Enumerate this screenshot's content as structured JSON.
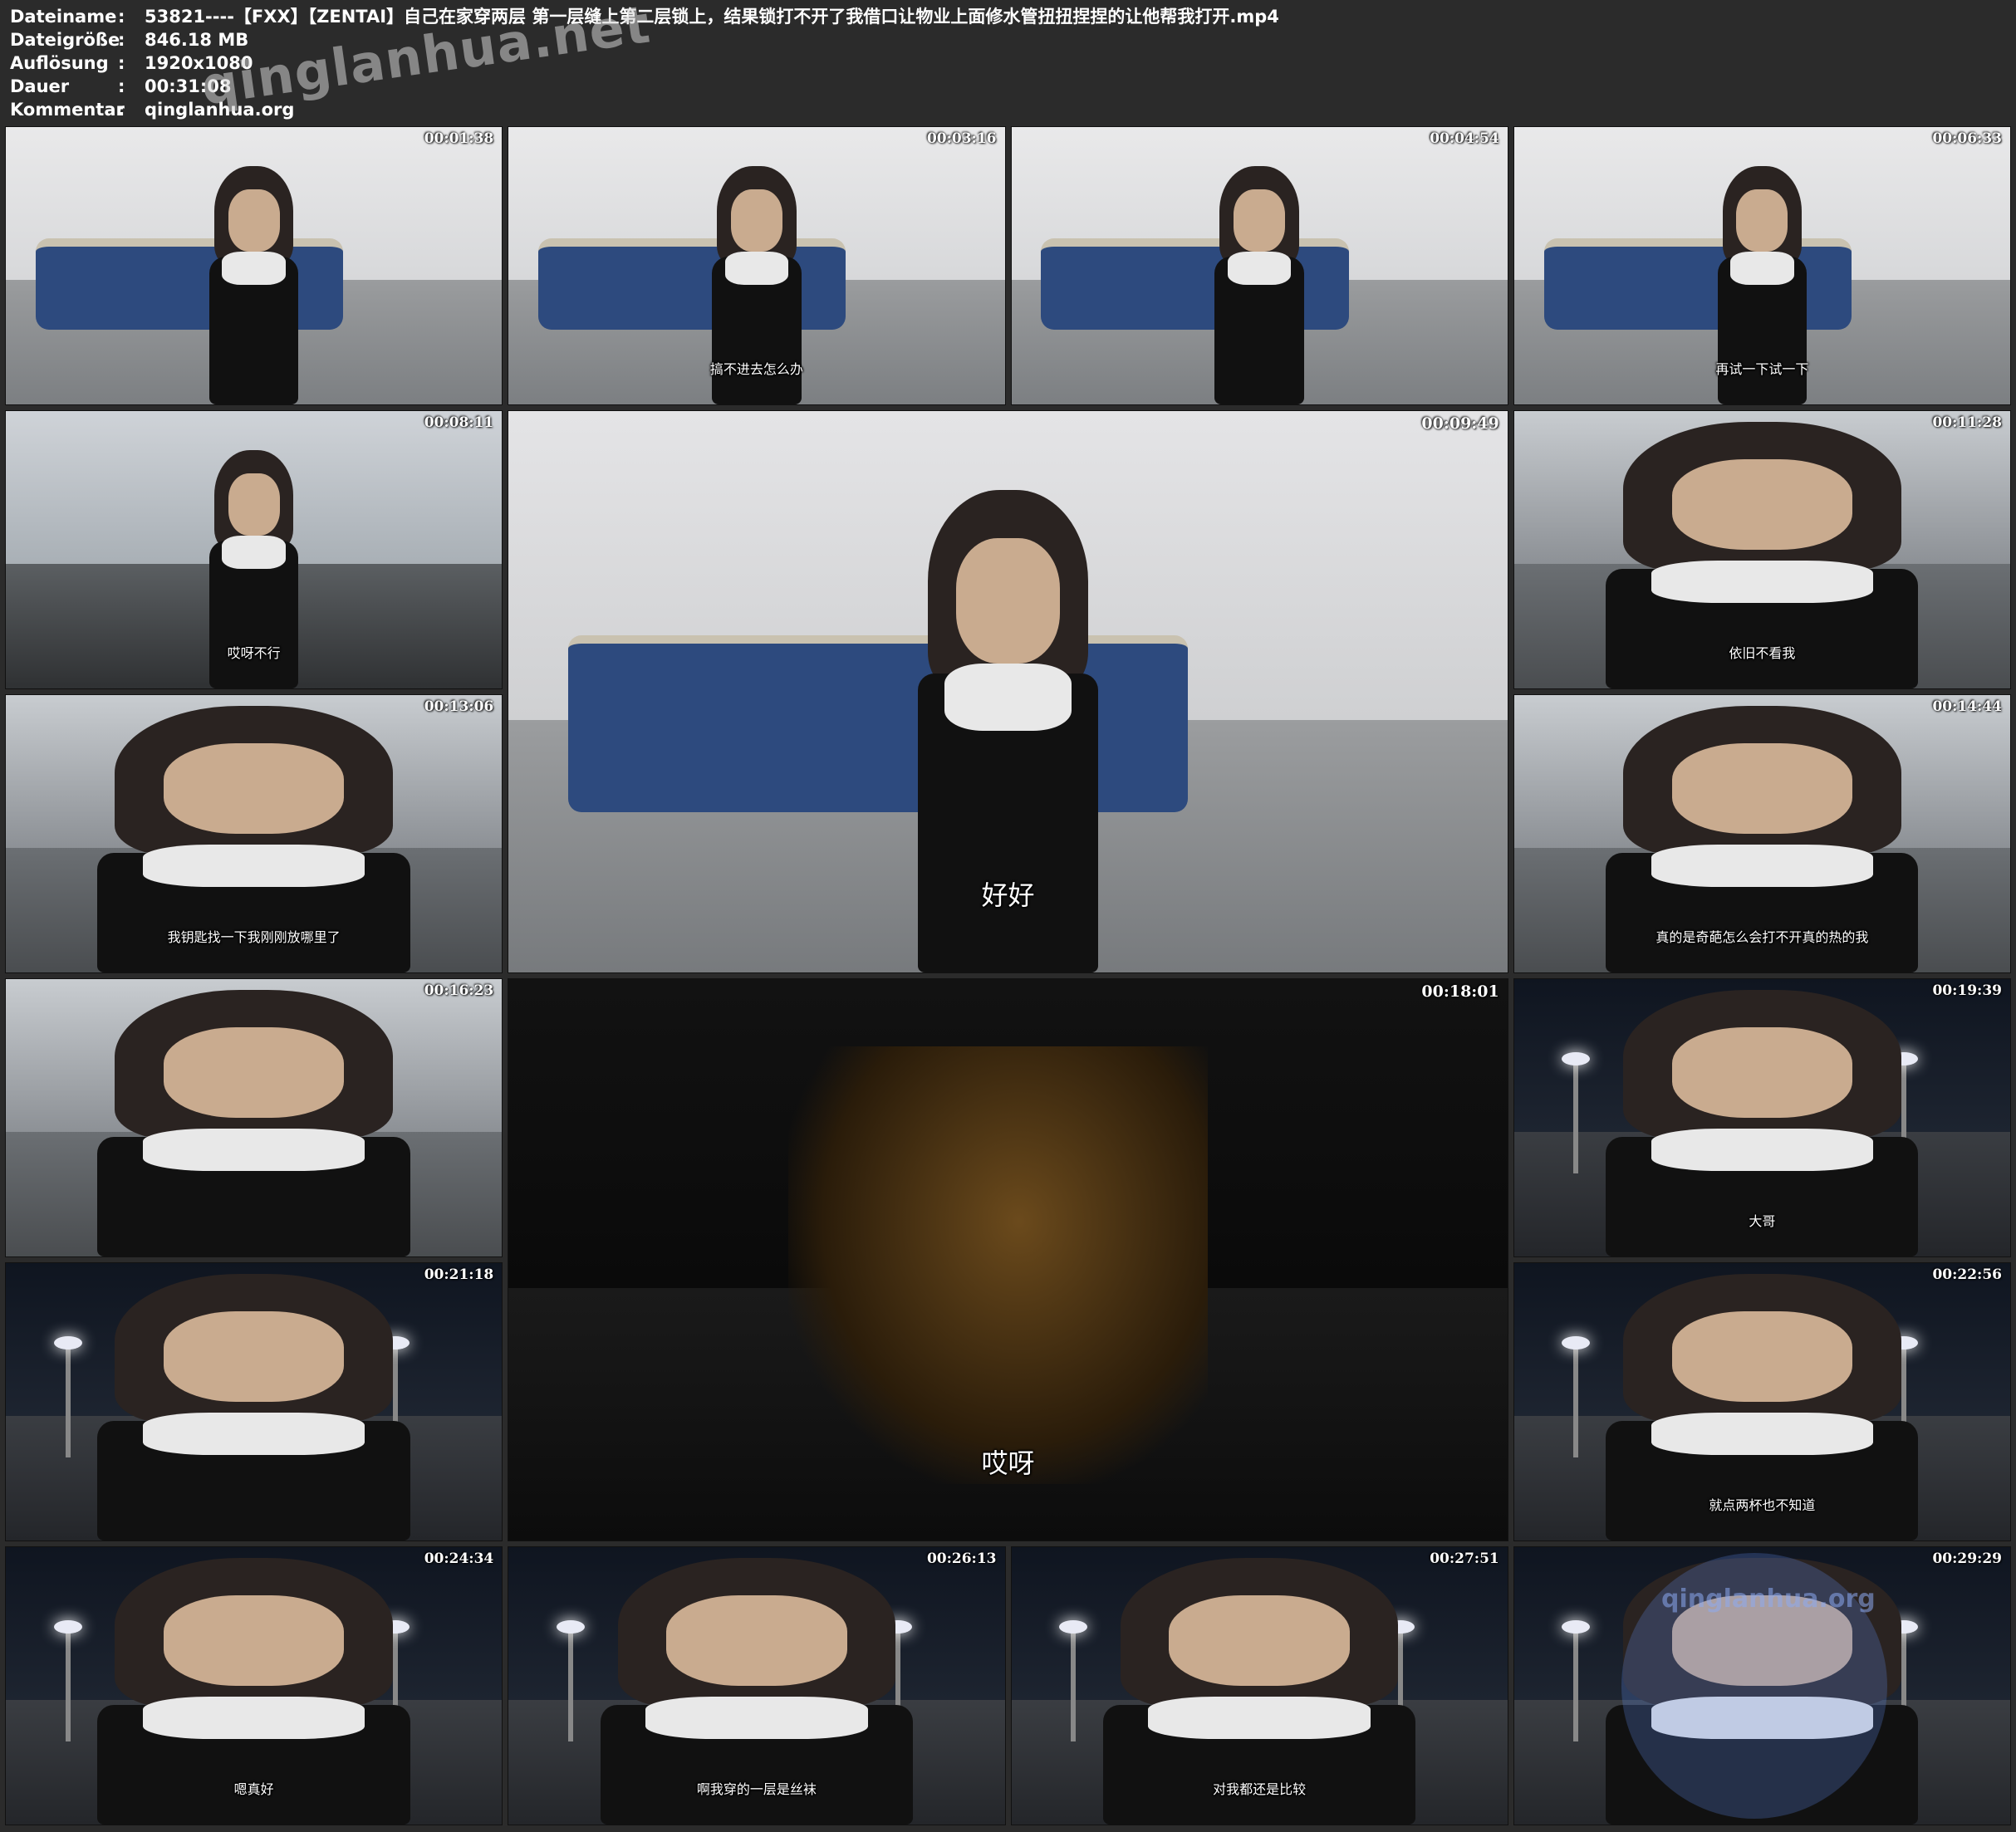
{
  "info": {
    "rows": [
      {
        "key": "Dateiname",
        "sep": ":",
        "value": "53821----【FXX】【ZENTAI】自己在家穿两层 第一层缝上第二层锁上，结果锁打不开了我借口让物业上面修水管扭扭捏捏的让他帮我打开.mp4"
      },
      {
        "key": "Dateigröße",
        "sep": ":",
        "value": "846.18 MB"
      },
      {
        "key": "Auflösung",
        "sep": ":",
        "value": "1920x1080"
      },
      {
        "key": "Dauer",
        "sep": ":",
        "value": "00:31:08"
      },
      {
        "key": "Kommentar",
        "sep": ":",
        "value": "qinglanhua.org"
      }
    ]
  },
  "watermark_top": "qinglanhua.net",
  "watermark_circle": "qinglanhua.org",
  "thumbnails": [
    {
      "time": "00:01:38",
      "subtitle": "",
      "scene": "room"
    },
    {
      "time": "00:03:16",
      "subtitle": "搞不进去怎么办",
      "scene": "room"
    },
    {
      "time": "00:04:54",
      "subtitle": "",
      "scene": "room"
    },
    {
      "time": "00:06:33",
      "subtitle": "再试一下试一下",
      "scene": "room"
    },
    {
      "time": "00:08:11",
      "subtitle": "哎呀不行",
      "scene": "hall"
    },
    {
      "time": "00:09:49",
      "subtitle": "好好",
      "scene": "room-big"
    },
    {
      "time": "00:11:28",
      "subtitle": "依旧不看我",
      "scene": "closeup-light"
    },
    {
      "time": "00:13:06",
      "subtitle": "我钥匙找一下我刚刚放哪里了",
      "scene": "closeup-light"
    },
    {
      "time": "00:14:44",
      "subtitle": "真的是奇葩怎么会打不开真的热的我",
      "scene": "closeup-light"
    },
    {
      "time": "00:16:23",
      "subtitle": "",
      "scene": "closeup-light"
    },
    {
      "time": "00:18:01",
      "subtitle": "哎呀",
      "scene": "dark-big"
    },
    {
      "time": "00:19:39",
      "subtitle": "大哥",
      "scene": "street"
    },
    {
      "time": "00:21:18",
      "subtitle": "",
      "scene": "street"
    },
    {
      "time": "00:22:56",
      "subtitle": "就点两杯也不知道",
      "scene": "street"
    },
    {
      "time": "00:24:34",
      "subtitle": "嗯真好",
      "scene": "street"
    },
    {
      "time": "00:26:13",
      "subtitle": "啊我穿的一层是丝袜",
      "scene": "street"
    },
    {
      "time": "00:27:51",
      "subtitle": "对我都还是比较",
      "scene": "street"
    },
    {
      "time": "00:29:29",
      "subtitle": "",
      "scene": "street"
    }
  ],
  "colors": {
    "background": "#2b2b2b",
    "text": "#ffffff",
    "sofa": "#2d4a7e"
  }
}
